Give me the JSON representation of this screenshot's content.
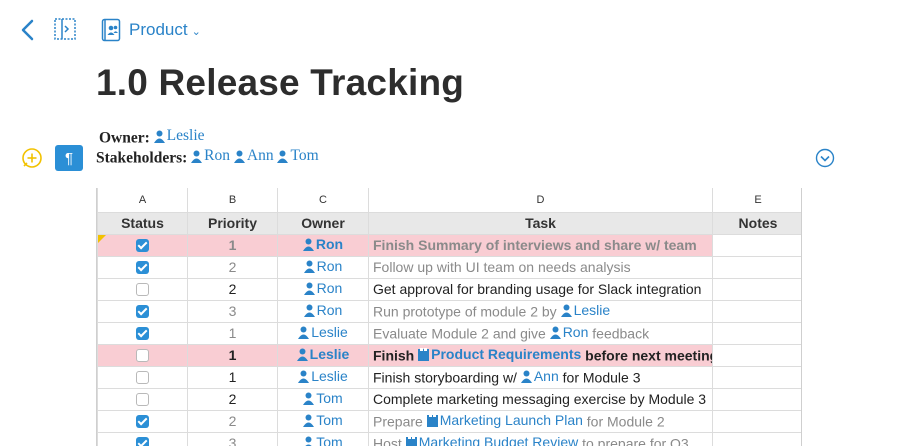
{
  "nav": {
    "folder": "Product"
  },
  "doc": {
    "title": "1.0 Release Tracking",
    "owner_label": "Owner:",
    "owner": "Leslie",
    "stakeholders_label": "Stakeholders:",
    "stakeholders": [
      "Ron",
      "Ann",
      "Tom"
    ]
  },
  "sheet": {
    "column_letters": [
      "A",
      "B",
      "C",
      "D",
      "E"
    ],
    "headers": [
      "Status",
      "Priority",
      "Owner",
      "Task",
      "Notes"
    ],
    "rows": [
      {
        "checked": true,
        "priority": "1",
        "owner": "Ron",
        "task": [
          {
            "t": "Finish Summary of interviews and share w/ team"
          }
        ],
        "style": "hl-done"
      },
      {
        "checked": true,
        "priority": "2",
        "owner": "Ron",
        "task": [
          {
            "t": "Follow up with UI team on needs analysis"
          }
        ],
        "style": "done"
      },
      {
        "checked": false,
        "priority": "2",
        "owner": "Ron",
        "task": [
          {
            "t": "Get approval for branding usage for Slack integration"
          }
        ],
        "style": "open"
      },
      {
        "checked": true,
        "priority": "3",
        "owner": "Ron",
        "task": [
          {
            "t": "Run prototype of module 2 by "
          },
          {
            "p": "Leslie"
          }
        ],
        "style": "done"
      },
      {
        "checked": true,
        "priority": "1",
        "owner": "Leslie",
        "task": [
          {
            "t": "Evaluate Module 2 and give "
          },
          {
            "p": "Ron"
          },
          {
            "t": " feedback"
          }
        ],
        "style": "done"
      },
      {
        "checked": false,
        "priority": "1",
        "owner": "Leslie",
        "task": [
          {
            "t": "Finish "
          },
          {
            "d": "Product Requirements"
          },
          {
            "t": " before next meeting"
          }
        ],
        "style": "hl-bold"
      },
      {
        "checked": false,
        "priority": "1",
        "owner": "Leslie",
        "task": [
          {
            "t": "Finish storyboarding w/ "
          },
          {
            "p": "Ann"
          },
          {
            "t": " for Module 3"
          }
        ],
        "style": "open"
      },
      {
        "checked": false,
        "priority": "2",
        "owner": "Tom",
        "task": [
          {
            "t": "Complete marketing messaging exercise by Module 3"
          }
        ],
        "style": "open"
      },
      {
        "checked": true,
        "priority": "2",
        "owner": "Tom",
        "task": [
          {
            "t": "Prepare "
          },
          {
            "d": "Marketing Launch Plan"
          },
          {
            "t": " for Module 2"
          }
        ],
        "style": "done"
      },
      {
        "checked": true,
        "priority": "3",
        "owner": "Tom",
        "task": [
          {
            "t": "Host "
          },
          {
            "d": "Marketing Budget Review"
          },
          {
            "t": " to prepare for Q3"
          }
        ],
        "style": "done"
      }
    ]
  },
  "colors": {
    "accent": "#2a83c8",
    "highlight": "#f9cdd3",
    "muted": "#8a8a8a"
  }
}
